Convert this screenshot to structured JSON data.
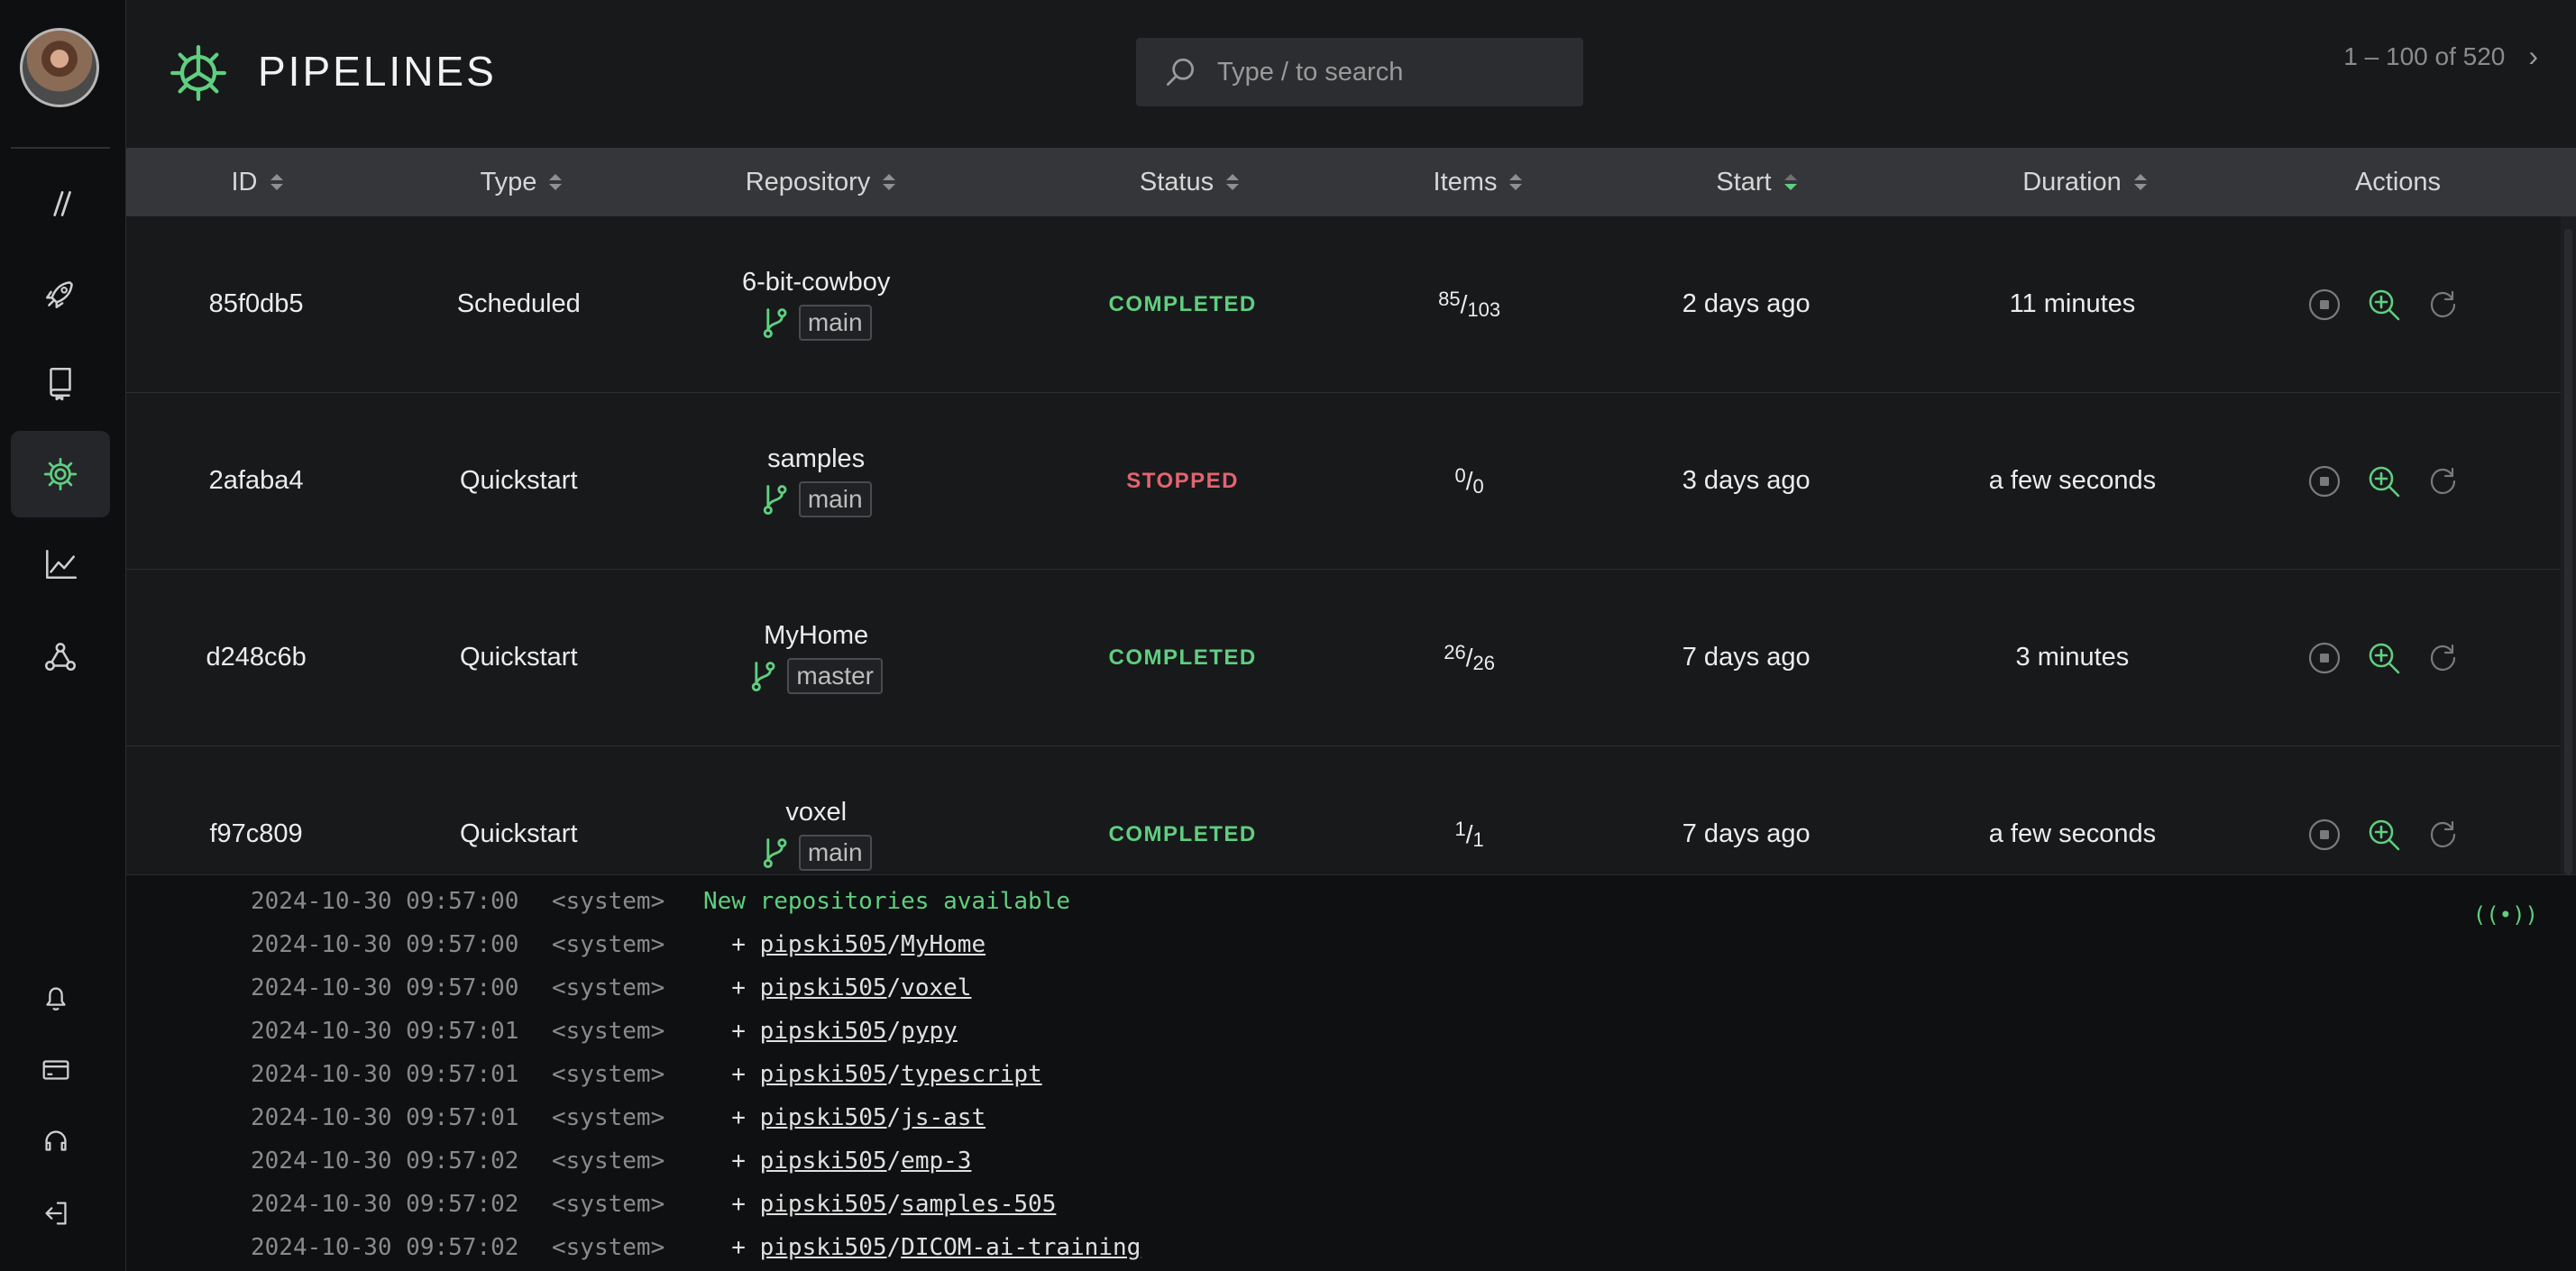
{
  "page": {
    "title": "PIPELINES"
  },
  "search": {
    "placeholder": "Type / to search"
  },
  "pagination": {
    "range": "1 – 100 of 520"
  },
  "sidebar": {
    "nav": [
      {
        "name": "pipelines-slash-icon",
        "active": false
      },
      {
        "name": "rocket-icon",
        "active": false
      },
      {
        "name": "repository-book-icon",
        "active": false
      },
      {
        "name": "gear-icon",
        "active": true
      },
      {
        "name": "chart-icon",
        "active": false
      },
      {
        "name": "webhook-icon",
        "active": false
      }
    ],
    "bottom": [
      "bell-icon",
      "credit-card-icon",
      "headset-icon",
      "logout-icon"
    ]
  },
  "table": {
    "columns": [
      "ID",
      "Type",
      "Repository",
      "Status",
      "Items",
      "Start",
      "Duration",
      "Actions"
    ],
    "rows": [
      {
        "id": "85f0db5",
        "type": "Scheduled",
        "repo": "6-bit-cowboy",
        "branch": "main",
        "status": "COMPLETED",
        "items_done": "85",
        "items_total": "103",
        "start": "2 days ago",
        "duration": "11 minutes"
      },
      {
        "id": "2afaba4",
        "type": "Quickstart",
        "repo": "samples",
        "branch": "main",
        "status": "STOPPED",
        "items_done": "0",
        "items_total": "0",
        "start": "3 days ago",
        "duration": "a few seconds"
      },
      {
        "id": "d248c6b",
        "type": "Quickstart",
        "repo": "MyHome",
        "branch": "master",
        "status": "COMPLETED",
        "items_done": "26",
        "items_total": "26",
        "start": "7 days ago",
        "duration": "3 minutes"
      },
      {
        "id": "f97c809",
        "type": "Quickstart",
        "repo": "voxel",
        "branch": "main",
        "status": "COMPLETED",
        "items_done": "1",
        "items_total": "1",
        "start": "7 days ago",
        "duration": "a few seconds"
      }
    ]
  },
  "log": {
    "live_indicator": "((•))",
    "lines": [
      {
        "ts": "2024-10-30 09:57:00",
        "src": "<system>",
        "msg": "New repositories available"
      },
      {
        "ts": "2024-10-30 09:57:00",
        "src": "<system>",
        "prefix": "  + ",
        "owner": "pipski505",
        "repo": "MyHome"
      },
      {
        "ts": "2024-10-30 09:57:00",
        "src": "<system>",
        "prefix": "  + ",
        "owner": "pipski505",
        "repo": "voxel"
      },
      {
        "ts": "2024-10-30 09:57:01",
        "src": "<system>",
        "prefix": "  + ",
        "owner": "pipski505",
        "repo": "pypy"
      },
      {
        "ts": "2024-10-30 09:57:01",
        "src": "<system>",
        "prefix": "  + ",
        "owner": "pipski505",
        "repo": "typescript"
      },
      {
        "ts": "2024-10-30 09:57:01",
        "src": "<system>",
        "prefix": "  + ",
        "owner": "pipski505",
        "repo": "js-ast"
      },
      {
        "ts": "2024-10-30 09:57:02",
        "src": "<system>",
        "prefix": "  + ",
        "owner": "pipski505",
        "repo": "emp-3"
      },
      {
        "ts": "2024-10-30 09:57:02",
        "src": "<system>",
        "prefix": "  + ",
        "owner": "pipski505",
        "repo": "samples-505"
      },
      {
        "ts": "2024-10-30 09:57:02",
        "src": "<system>",
        "prefix": "  + ",
        "owner": "pipski505",
        "repo": "DICOM-ai-training"
      }
    ]
  },
  "colors": {
    "accent": "#5fcf80",
    "stopped": "#e4636f",
    "background": "#18191b"
  }
}
